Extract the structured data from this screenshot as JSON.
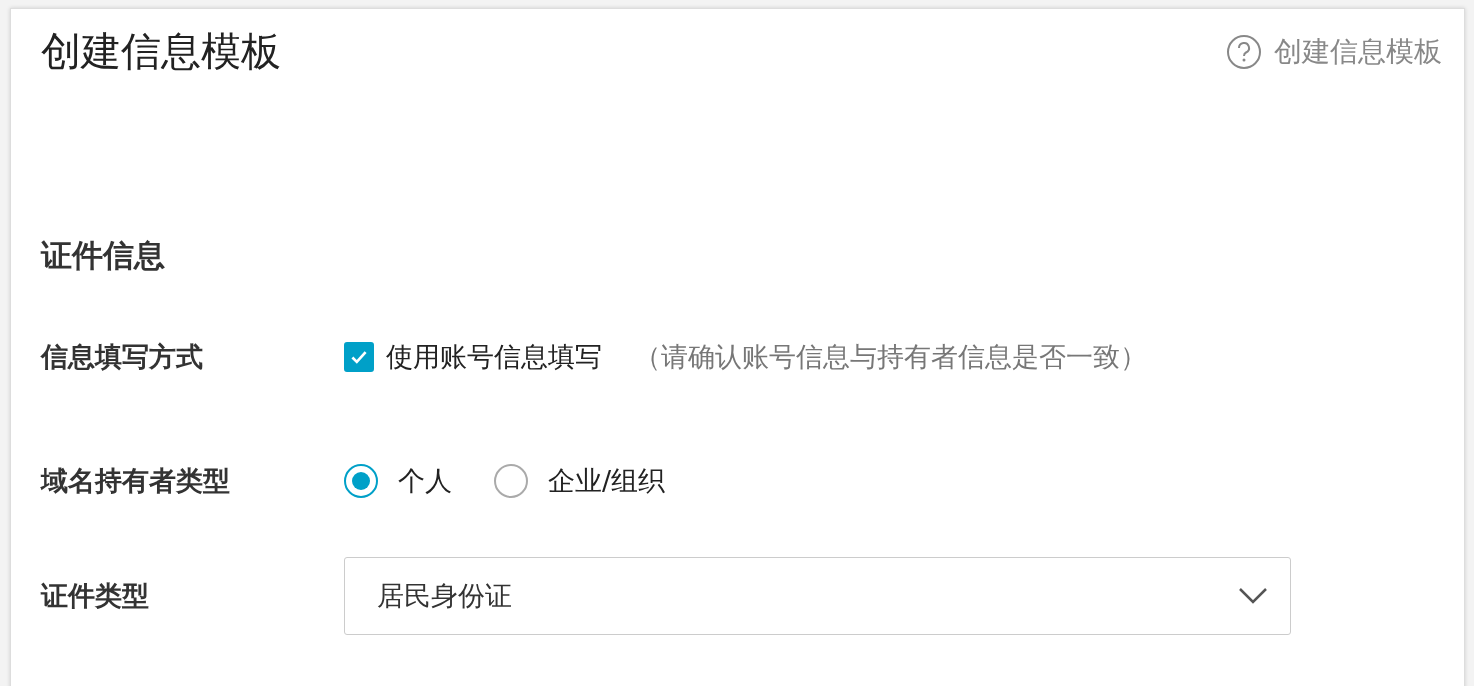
{
  "title": "创建信息模板",
  "help_link": "创建信息模板",
  "section": {
    "title": "证件信息"
  },
  "fields": [
    {
      "kind": "checkbox",
      "label": "信息填写方式",
      "option": "使用账号信息填写",
      "checked": true,
      "hint": "（请确认账号信息与持有者信息是否一致）"
    },
    {
      "kind": "radio",
      "label": "域名持有者类型",
      "options": [
        {
          "label": "个人",
          "selected": true
        },
        {
          "label": "企业/组织",
          "selected": false
        }
      ]
    },
    {
      "kind": "select",
      "label": "证件类型",
      "value": "居民身份证"
    }
  ]
}
